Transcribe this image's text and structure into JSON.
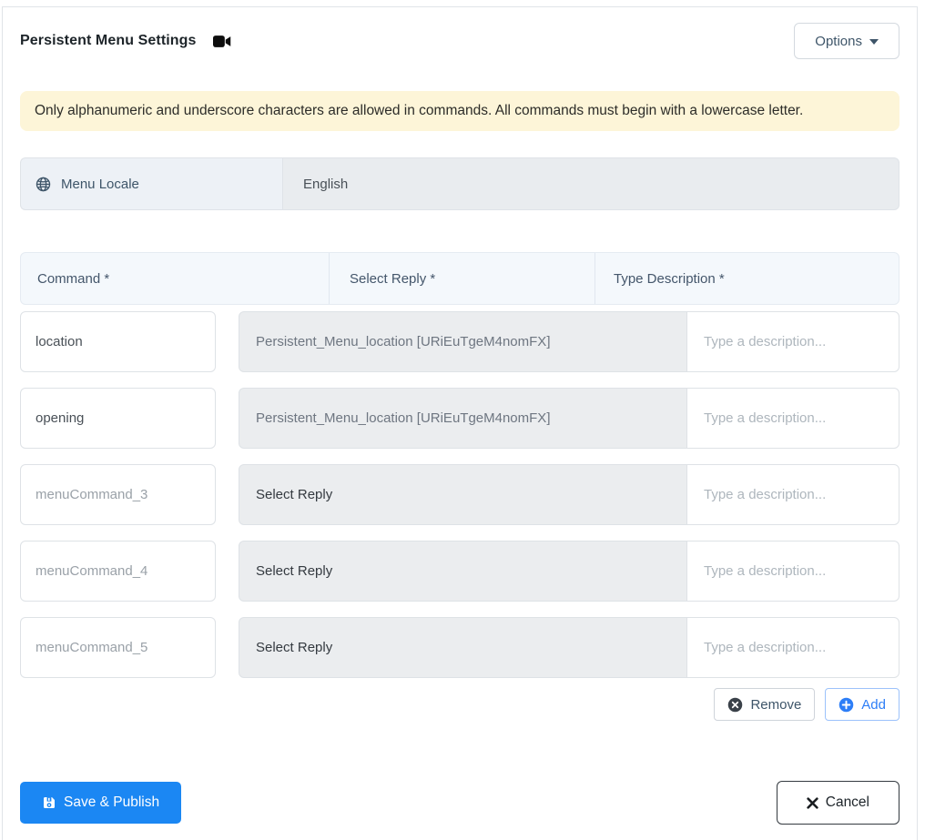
{
  "header": {
    "title": "Persistent Menu Settings",
    "title_icon": "video-camera-icon",
    "options_label": "Options"
  },
  "alert": {
    "text": "Only alphanumeric and underscore characters are allowed in commands. All commands must begin with a lowercase letter."
  },
  "locale": {
    "icon": "globe-icon",
    "label": "Menu Locale",
    "value": "English"
  },
  "table": {
    "headers": [
      "Command *",
      "Select Reply *",
      "Type Description *"
    ],
    "rows": [
      {
        "command": "location",
        "command_is_placeholder": false,
        "reply": "Persistent_Menu_location [URiEuTgeM4nomFX]",
        "reply_selected": true,
        "description_placeholder": "Type a description..."
      },
      {
        "command": "opening",
        "command_is_placeholder": false,
        "reply": "Persistent_Menu_location [URiEuTgeM4nomFX]",
        "reply_selected": true,
        "description_placeholder": "Type a description..."
      },
      {
        "command": "menuCommand_3",
        "command_is_placeholder": true,
        "reply": "Select Reply",
        "reply_selected": false,
        "description_placeholder": "Type a description..."
      },
      {
        "command": "menuCommand_4",
        "command_is_placeholder": true,
        "reply": "Select Reply",
        "reply_selected": false,
        "description_placeholder": "Type a description..."
      },
      {
        "command": "menuCommand_5",
        "command_is_placeholder": true,
        "reply": "Select Reply",
        "reply_selected": false,
        "description_placeholder": "Type a description..."
      }
    ],
    "remove_label": "Remove",
    "remove_icon": "x-circle-icon",
    "add_label": "Add",
    "add_icon": "plus-circle-icon"
  },
  "footer": {
    "save_label": "Save & Publish",
    "save_icon": "save-floppy-icon",
    "cancel_label": "Cancel",
    "cancel_icon": "x-icon"
  },
  "colors": {
    "primary_blue": "#1b87f3",
    "link_blue": "#2d7ef7",
    "warning_bg": "#fdf5d8",
    "addon_bg": "#edf1f6",
    "disabled_bg": "#e9ecef",
    "header_row_bg": "#f4f8fc",
    "border": "#dee2e6",
    "text_dark": "#212529",
    "text_slate": "#3e5569",
    "text_muted": "#6e7681",
    "placeholder": "#9aa1a8"
  }
}
